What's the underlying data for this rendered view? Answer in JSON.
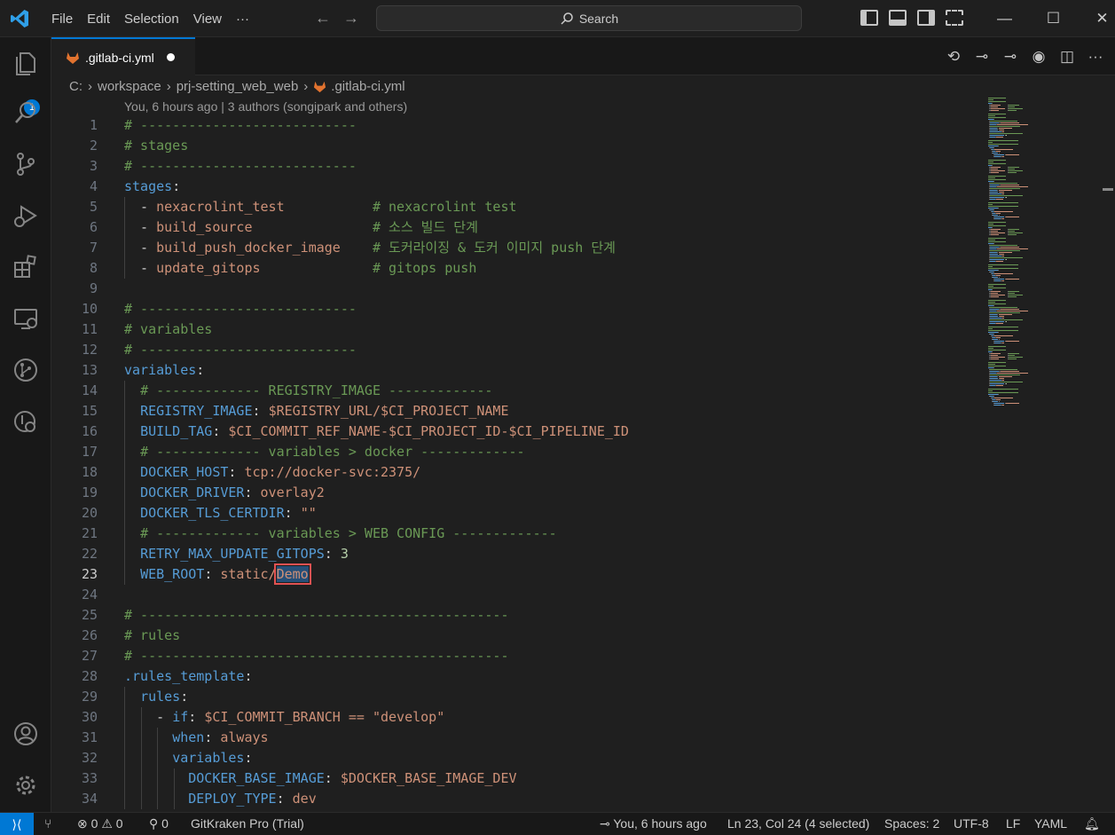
{
  "menu": {
    "file": "File",
    "edit": "Edit",
    "selection": "Selection",
    "view": "View",
    "more": "···"
  },
  "search": {
    "label": "Search"
  },
  "explorer_badge": "1",
  "tab": {
    "filename": ".gitlab-ci.yml"
  },
  "breadcrumb": {
    "drive": "C:",
    "folder1": "workspace",
    "folder2": "prj-setting_web_web",
    "file": ".gitlab-ci.yml"
  },
  "blame": "You, 6 hours ago | 3 authors (songipark and others)",
  "lines": [
    {
      "n": "1",
      "parts": [
        [
          "c-com",
          "# ---------------------------"
        ]
      ]
    },
    {
      "n": "2",
      "parts": [
        [
          "c-com",
          "# stages"
        ]
      ]
    },
    {
      "n": "3",
      "parts": [
        [
          "c-com",
          "# ---------------------------"
        ]
      ]
    },
    {
      "n": "4",
      "parts": [
        [
          "c-key",
          "stages"
        ],
        [
          "c-txt",
          ":"
        ]
      ]
    },
    {
      "n": "5",
      "parts": [
        [
          "c-txt",
          "  - "
        ],
        [
          "c-val",
          "nexacrolint_test"
        ],
        [
          "c-txt",
          "           "
        ],
        [
          "c-com",
          "# nexacrolint test"
        ]
      ]
    },
    {
      "n": "6",
      "parts": [
        [
          "c-txt",
          "  - "
        ],
        [
          "c-val",
          "build_source"
        ],
        [
          "c-txt",
          "               "
        ],
        [
          "c-com",
          "# 소스 빌드 단계"
        ]
      ]
    },
    {
      "n": "7",
      "parts": [
        [
          "c-txt",
          "  - "
        ],
        [
          "c-val",
          "build_push_docker_image"
        ],
        [
          "c-txt",
          "    "
        ],
        [
          "c-com",
          "# 도커라이징 & 도커 이미지 push 단계"
        ]
      ]
    },
    {
      "n": "8",
      "parts": [
        [
          "c-txt",
          "  - "
        ],
        [
          "c-val",
          "update_gitops"
        ],
        [
          "c-txt",
          "              "
        ],
        [
          "c-com",
          "# gitops push"
        ]
      ]
    },
    {
      "n": "9",
      "parts": []
    },
    {
      "n": "10",
      "parts": [
        [
          "c-com",
          "# ---------------------------"
        ]
      ]
    },
    {
      "n": "11",
      "parts": [
        [
          "c-com",
          "# variables"
        ]
      ]
    },
    {
      "n": "12",
      "parts": [
        [
          "c-com",
          "# ---------------------------"
        ]
      ]
    },
    {
      "n": "13",
      "parts": [
        [
          "c-key",
          "variables"
        ],
        [
          "c-txt",
          ":"
        ]
      ]
    },
    {
      "n": "14",
      "parts": [
        [
          "c-txt",
          "  "
        ],
        [
          "c-com",
          "# ------------- REGISTRY_IMAGE -------------"
        ]
      ]
    },
    {
      "n": "15",
      "parts": [
        [
          "c-txt",
          "  "
        ],
        [
          "c-key",
          "REGISTRY_IMAGE"
        ],
        [
          "c-txt",
          ": "
        ],
        [
          "c-val",
          "$REGISTRY_URL/$CI_PROJECT_NAME"
        ]
      ]
    },
    {
      "n": "16",
      "parts": [
        [
          "c-txt",
          "  "
        ],
        [
          "c-key",
          "BUILD_TAG"
        ],
        [
          "c-txt",
          ": "
        ],
        [
          "c-val",
          "$CI_COMMIT_REF_NAME-$CI_PROJECT_ID-$CI_PIPELINE_ID"
        ]
      ]
    },
    {
      "n": "17",
      "parts": [
        [
          "c-txt",
          "  "
        ],
        [
          "c-com",
          "# ------------- variables > docker -------------"
        ]
      ]
    },
    {
      "n": "18",
      "parts": [
        [
          "c-txt",
          "  "
        ],
        [
          "c-key",
          "DOCKER_HOST"
        ],
        [
          "c-txt",
          ": "
        ],
        [
          "c-val",
          "tcp://docker-svc:2375/"
        ]
      ]
    },
    {
      "n": "19",
      "parts": [
        [
          "c-txt",
          "  "
        ],
        [
          "c-key",
          "DOCKER_DRIVER"
        ],
        [
          "c-txt",
          ": "
        ],
        [
          "c-val",
          "overlay2"
        ]
      ]
    },
    {
      "n": "20",
      "parts": [
        [
          "c-txt",
          "  "
        ],
        [
          "c-key",
          "DOCKER_TLS_CERTDIR"
        ],
        [
          "c-txt",
          ": "
        ],
        [
          "c-val",
          "\"\""
        ]
      ]
    },
    {
      "n": "21",
      "parts": [
        [
          "c-txt",
          "  "
        ],
        [
          "c-com",
          "# ------------- variables > WEB CONFIG -------------"
        ]
      ]
    },
    {
      "n": "22",
      "parts": [
        [
          "c-txt",
          "  "
        ],
        [
          "c-key",
          "RETRY_MAX_UPDATE_GITOPS"
        ],
        [
          "c-txt",
          ": "
        ],
        [
          "c-num",
          "3"
        ]
      ]
    },
    {
      "n": "23",
      "parts": [
        [
          "c-txt",
          "  "
        ],
        [
          "c-key",
          "WEB_ROOT"
        ],
        [
          "c-txt",
          ": "
        ],
        [
          "c-val",
          "static/"
        ],
        [
          "c-val sel",
          "Demo"
        ]
      ]
    },
    {
      "n": "24",
      "parts": []
    },
    {
      "n": "25",
      "parts": [
        [
          "c-com",
          "# ----------------------------------------------"
        ]
      ]
    },
    {
      "n": "26",
      "parts": [
        [
          "c-com",
          "# rules"
        ]
      ]
    },
    {
      "n": "27",
      "parts": [
        [
          "c-com",
          "# ----------------------------------------------"
        ]
      ]
    },
    {
      "n": "28",
      "parts": [
        [
          "c-key",
          ".rules_template"
        ],
        [
          "c-txt",
          ":"
        ]
      ]
    },
    {
      "n": "29",
      "parts": [
        [
          "c-txt",
          "  "
        ],
        [
          "c-key",
          "rules"
        ],
        [
          "c-txt",
          ":"
        ]
      ]
    },
    {
      "n": "30",
      "parts": [
        [
          "c-txt",
          "    - "
        ],
        [
          "c-key",
          "if"
        ],
        [
          "c-txt",
          ": "
        ],
        [
          "c-val",
          "$CI_COMMIT_BRANCH == \"develop\""
        ]
      ]
    },
    {
      "n": "31",
      "parts": [
        [
          "c-txt",
          "      "
        ],
        [
          "c-key",
          "when"
        ],
        [
          "c-txt",
          ": "
        ],
        [
          "c-val",
          "always"
        ]
      ]
    },
    {
      "n": "32",
      "parts": [
        [
          "c-txt",
          "      "
        ],
        [
          "c-key",
          "variables"
        ],
        [
          "c-txt",
          ":"
        ]
      ]
    },
    {
      "n": "33",
      "parts": [
        [
          "c-txt",
          "        "
        ],
        [
          "c-key",
          "DOCKER_BASE_IMAGE"
        ],
        [
          "c-txt",
          ": "
        ],
        [
          "c-val",
          "$DOCKER_BASE_IMAGE_DEV"
        ]
      ]
    },
    {
      "n": "34",
      "parts": [
        [
          "c-txt",
          "        "
        ],
        [
          "c-key",
          "DEPLOY_TYPE"
        ],
        [
          "c-txt",
          ": "
        ],
        [
          "c-val",
          "dev"
        ]
      ]
    }
  ],
  "current_line": "23",
  "status": {
    "errors": "0",
    "warnings": "0",
    "ports": "0",
    "gitkraken": "GitKraken Pro (Trial)",
    "blame": "You, 6 hours ago",
    "cursor": "Ln 23, Col 24 (4 selected)",
    "spaces": "Spaces: 2",
    "encoding": "UTF-8",
    "eol": "LF",
    "language": "YAML"
  },
  "colors": {
    "accent": "#0078d4",
    "comment": "#6a9955",
    "key": "#569cd6",
    "string": "#ce9178",
    "selection_outline": "#e05252"
  }
}
